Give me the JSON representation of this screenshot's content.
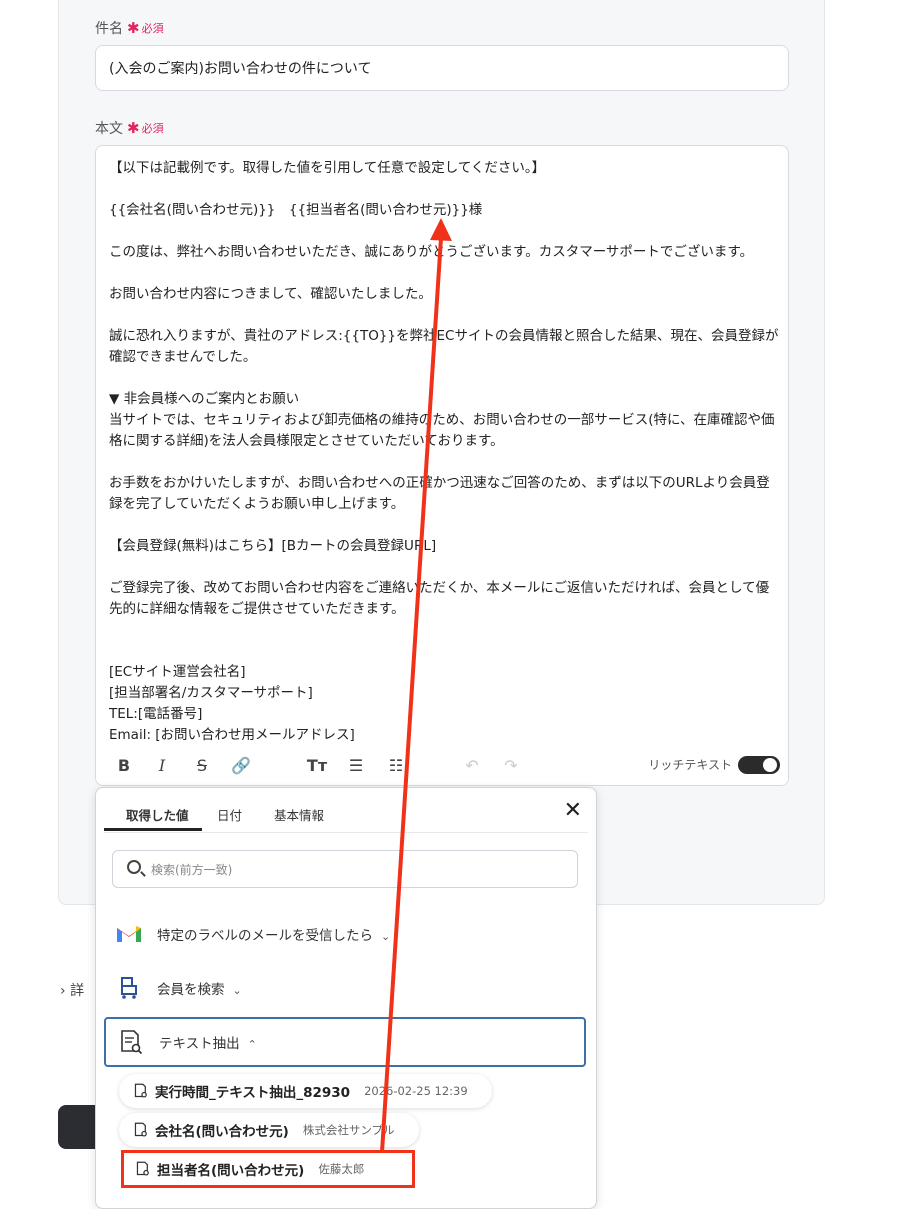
{
  "form": {
    "subject_label": "件名",
    "body_label": "本文",
    "required_mark": "必須",
    "subject_value": "(入会のご案内)お問い合わせの件について",
    "body_text": "【以下は記載例です。取得した値を引用して任意で設定してください。】\n\n{{会社名(問い合わせ元)}}　{{担当者名(問い合わせ元)}}様\n\nこの度は、弊社へお問い合わせいただき、誠にありがとうございます。カスタマーサポートでございます。\n\nお問い合わせ内容につきまして、確認いたしました。\n\n誠に恐れ入りますが、貴社のアドレス:{{TO}}を弊社ECサイトの会員情報と照合した結果、現在、会員登録が確認できませんでした。\n\n▼ 非会員様へのご案内とお願い\n当サイトでは、セキュリティおよび卸売価格の維持のため、お問い合わせの一部サービス(特に、在庫確認や価格に関する詳細)を法人会員様限定とさせていただいております。\n\nお手数をおかけいたしますが、お問い合わせへの正確かつ迅速なご回答のため、まずは以下のURLより会員登録を完了していただくようお願い申し上げます。\n\n【会員登録(無料)はこちら】[Bカートの会員登録URL]\n\nご登録完了後、改めてお問い合わせ内容をご連絡いただくか、本メールにご返信いただければ、会員として優先的に詳細な情報をご提供させていただきます。\n\n\n[ECサイト運営会社名]\n[担当部署名/カスタマーサポート]\nTEL:[電話番号]\nEmail: [お問い合わせ用メールアドレス]",
    "rich_text_label": "リッチテキスト"
  },
  "popup": {
    "tabs": [
      "取得した値",
      "日付",
      "基本情報"
    ],
    "search_placeholder": "検索(前方一致)",
    "sections": [
      {
        "label": "特定のラベルのメールを受信したら",
        "icon": "gmail-icon"
      },
      {
        "label": "会員を検索",
        "icon": "bcart-icon"
      },
      {
        "label": "テキスト抽出",
        "icon": "text-extract-icon"
      }
    ],
    "items": [
      {
        "name": "実行時間_テキスト抽出_82930",
        "value": "2026-02-25 12:39"
      },
      {
        "name": "会社名(問い合わせ元)",
        "value": "株式会社サンプル"
      },
      {
        "name": "担当者名(問い合わせ元)",
        "value": "佐藤太郎"
      }
    ]
  },
  "sidebar": {
    "detail_label": "詳"
  },
  "colors": {
    "required": "#e0245e",
    "highlight": "#f0321a",
    "active_border": "#3e6fa8"
  }
}
